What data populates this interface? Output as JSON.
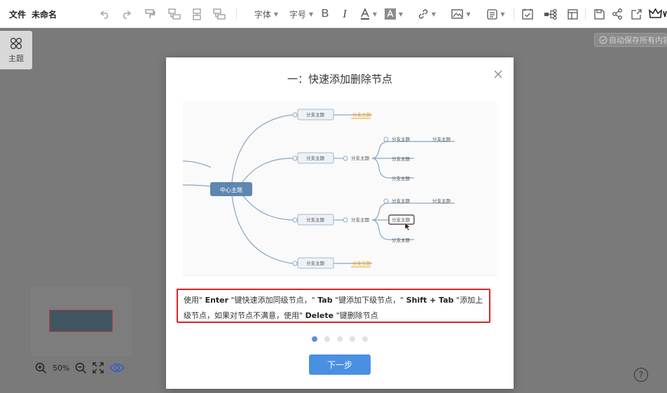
{
  "toolbar": {
    "file_menu": "文件",
    "doc_name": "未命名",
    "font_label": "字体",
    "font_size_label": "字号"
  },
  "sidebar": {
    "theme_label": "主题"
  },
  "status": {
    "autosave": "自动保存所有内容"
  },
  "zoom": {
    "level": "50%"
  },
  "help": {
    "label": "?"
  },
  "modal": {
    "title": "一：快速添加删除节点",
    "description": {
      "p1": "使用\" ",
      "k1": "Enter",
      "p2": " \"键快速添加同级节点，\" ",
      "k2": "Tab",
      "p3": " \"键添加下级节点，\" ",
      "k3": "Shift + Tab",
      "p4": " \"添加上级节点，如果对节点不满意，使用\" ",
      "k4": "Delete",
      "p5": " \"键删除节点"
    },
    "next_button": "下一步",
    "step_total": 5,
    "step_current": 1
  },
  "illustration": {
    "center": "中心主题",
    "branch": "分支主题",
    "accent_color": "#e8a317",
    "node_color": "#5f86b0"
  }
}
